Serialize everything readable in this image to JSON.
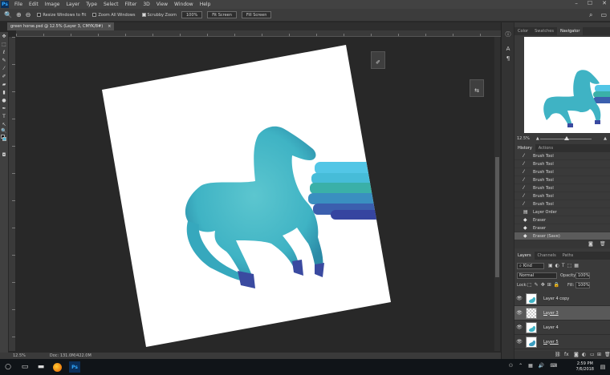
{
  "app": {
    "logo": "Ps",
    "menu": [
      "File",
      "Edit",
      "Image",
      "Layer",
      "Type",
      "Select",
      "Filter",
      "3D",
      "View",
      "Window",
      "Help"
    ],
    "window_controls": [
      "–",
      "☐",
      "✕"
    ]
  },
  "options_bar": {
    "resize_windows_label": "Resize Windows to Fit",
    "zoom_all_label": "Zoom All Windows",
    "scrubby_zoom_label": "Scrubby Zoom",
    "btn_100": "100%",
    "btn_fit": "Fit Screen",
    "btn_fill": "Fill Screen"
  },
  "document": {
    "tab_title": "green horse.psd @ 12.5% (Layer 3, CMYK/8#)",
    "close": "×"
  },
  "status_bar": {
    "zoom": "12.5%",
    "doc_size": "Doc: 131.0M/422.0M"
  },
  "panels": {
    "top_tabs": [
      "Color",
      "Swatches",
      "Navigator"
    ],
    "active_top_tab": "Navigator",
    "navigator_zoom": "12.5%",
    "history_tabs": [
      "History",
      "Actions"
    ],
    "history_items": [
      {
        "label": "Brush Tool",
        "icon": "brush-icon"
      },
      {
        "label": "Brush Tool",
        "icon": "brush-icon"
      },
      {
        "label": "Brush Tool",
        "icon": "brush-icon"
      },
      {
        "label": "Brush Tool",
        "icon": "brush-icon"
      },
      {
        "label": "Brush Tool",
        "icon": "brush-icon"
      },
      {
        "label": "Brush Tool",
        "icon": "brush-icon"
      },
      {
        "label": "Brush Tool",
        "icon": "brush-icon"
      },
      {
        "label": "Layer Order",
        "icon": "layer-order-icon"
      },
      {
        "label": "Eraser",
        "icon": "eraser-icon"
      },
      {
        "label": "Eraser",
        "icon": "eraser-icon"
      },
      {
        "label": "Eraser (Save)",
        "icon": "eraser-icon"
      }
    ],
    "layers_tabs": [
      "Layers",
      "Channels",
      "Paths"
    ],
    "kind_label": "Kind",
    "blend_mode": "Normal",
    "opacity_label": "Opacity:",
    "opacity_value": "100%",
    "lock_label": "Lock:",
    "fill_label": "Fill:",
    "fill_value": "100%",
    "layers": [
      {
        "name": "Layer 4 copy",
        "selected": false,
        "underlined": false
      },
      {
        "name": "Layer 3",
        "selected": true,
        "underlined": true
      },
      {
        "name": "Layer 4",
        "selected": false,
        "underlined": false
      },
      {
        "name": "Layer 5",
        "selected": false,
        "underlined": true
      }
    ]
  },
  "taskbar": {
    "time": "2:59 PM",
    "date": "7/6/2018"
  },
  "colors": {
    "horse_main": "#3fb3c4",
    "horse_dark": "#2a7f9c",
    "hoof": "#3a4aa0",
    "stroke_light": "#52c6e6",
    "stroke_teal": "#3ab0a8",
    "stroke_blue": "#3b5fae"
  }
}
